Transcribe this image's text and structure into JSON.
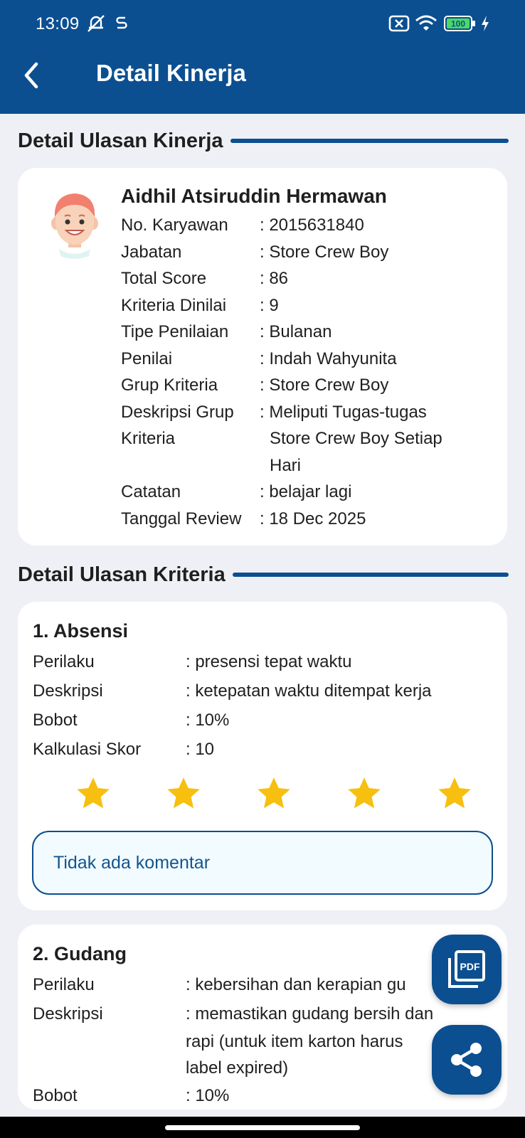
{
  "status_bar": {
    "time": "13:09",
    "battery": "100",
    "icons": [
      "mute-icon",
      "s-app-icon",
      "no-sim-icon",
      "wifi-icon",
      "battery-icon",
      "charging-icon"
    ]
  },
  "app_bar": {
    "title": "Detail Kinerja",
    "back_icon": "back-arrow-icon"
  },
  "section_performance": {
    "title": "Detail Ulasan Kinerja"
  },
  "employee": {
    "name": "Aidhil Atsiruddin Hermawan",
    "fields": [
      {
        "label": "No. Karyawan",
        "value": ": 2015631840"
      },
      {
        "label": "Jabatan",
        "value": ": Store Crew Boy"
      },
      {
        "label": "Total Score",
        "value": ": 86"
      },
      {
        "label": "Kriteria Dinilai",
        "value": ": 9"
      },
      {
        "label": "Tipe Penilaian",
        "value": ": Bulanan"
      },
      {
        "label": "Penilai",
        "value": ": Indah Wahyunita"
      },
      {
        "label": "Grup Kriteria",
        "value": ": Store Crew Boy"
      },
      {
        "label": "Deskripsi Grup",
        "value": ": Meliputi Tugas-tugas"
      },
      {
        "label": "Kriteria",
        "value": "Store Crew Boy Setiap"
      },
      {
        "label": "",
        "value": "Hari"
      },
      {
        "label": "Catatan",
        "value": ": belajar lagi"
      },
      {
        "label": "Tanggal Review",
        "value": ": 18 Dec 2025"
      }
    ]
  },
  "section_criteria": {
    "title": "Detail Ulasan Kriteria"
  },
  "criteria": [
    {
      "title": "1. Absensi",
      "rows": [
        {
          "label": "Perilaku",
          "value": ": presensi tepat waktu"
        },
        {
          "label": "Deskripsi",
          "value": ": ketepatan waktu ditempat kerja"
        },
        {
          "label": "Bobot",
          "value": ": 10%"
        },
        {
          "label": "Kalkulasi Skor",
          "value": ": 10"
        }
      ],
      "rating": 5,
      "rating_max": 5,
      "comment": "Tidak ada komentar"
    },
    {
      "title": "2. Gudang",
      "rows": [
        {
          "label": "Perilaku",
          "value": ": kebersihan dan kerapian gu"
        },
        {
          "label": "Deskripsi",
          "value": ": memastikan gudang bersih dan"
        },
        {
          "label": "",
          "value": "rapi (untuk item karton harus"
        },
        {
          "label": "",
          "value": "label expired)"
        },
        {
          "label": "Bobot",
          "value": ": 10%"
        }
      ]
    }
  ],
  "fabs": {
    "pdf_icon": "pdf-icon",
    "pdf_text": "PDF",
    "share_icon": "share-icon"
  },
  "colors": {
    "primary": "#0b4f91",
    "star": "#f7bf0f",
    "background": "#eef0f5",
    "card": "#ffffff"
  }
}
